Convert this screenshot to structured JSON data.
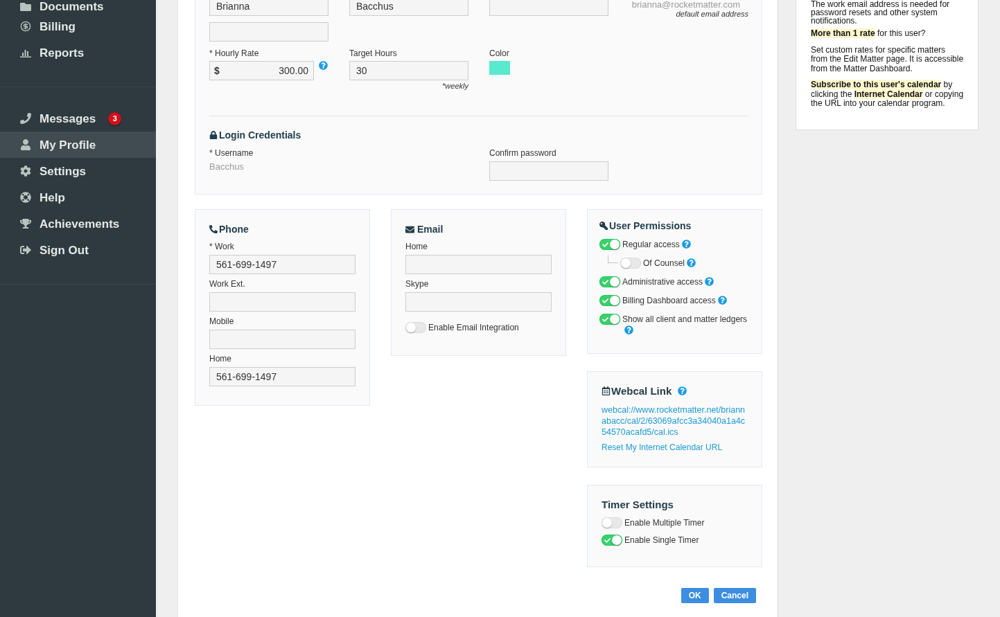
{
  "sidebar": {
    "groups": [
      {
        "items": [
          {
            "label": "Documents",
            "selected": false
          },
          {
            "label": "Billing",
            "selected": false
          },
          {
            "label": "Reports",
            "selected": false
          }
        ]
      },
      {
        "items": [
          {
            "label": "Messages",
            "selected": false,
            "badge": "3"
          },
          {
            "label": "My Profile",
            "selected": true
          },
          {
            "label": "Settings",
            "selected": false
          },
          {
            "label": "Help",
            "selected": false
          },
          {
            "label": "Achievements",
            "selected": false
          },
          {
            "label": "Sign Out",
            "selected": false
          }
        ]
      }
    ]
  },
  "profile": {
    "name_row": [
      "Brianna",
      "Bacchus"
    ],
    "email": "brianna@rocketmatter.com",
    "email_note": "default email address",
    "hourly_rate": {
      "label": "* Hourly Rate",
      "prefix": "$",
      "value": "300.00"
    },
    "target_hours": {
      "label": "Target Hours",
      "value": "30",
      "note": "*weekly"
    },
    "color": {
      "label": "Color",
      "color": "#58eacd"
    }
  },
  "login": {
    "title": "Login Credentials",
    "username_label": "* Username",
    "username": "Bacchus",
    "confirm_label": "Confirm password"
  },
  "phone": {
    "title": "Phone",
    "fields": [
      {
        "label": "* Work",
        "value": "561-699-1497"
      },
      {
        "label": "Work Ext."
      },
      {
        "label": "Mobile"
      },
      {
        "label": "Home",
        "value": "561-699-1497"
      }
    ]
  },
  "email": {
    "title": "Email",
    "fields": [
      {
        "label": "Home"
      },
      {
        "label": "Skype"
      }
    ],
    "integration": {
      "label": "Enable Email Integration",
      "on": false
    }
  },
  "permissions": {
    "title": "User Permissions",
    "items": [
      {
        "label": "Regular access",
        "on": true,
        "children": [
          {
            "label": "Of Counsel",
            "on": false
          }
        ]
      },
      {
        "label": "Administrative access",
        "on": true
      },
      {
        "label": "Billing Dashboard access",
        "on": true
      },
      {
        "label": "Show all client and matter ledgers",
        "on": true
      }
    ]
  },
  "webcal": {
    "title": "Webcal Link",
    "url": "webcal://www.rocketmatter.net/briannabacc/cal/2/63069afcc3a34040a1a4c54570acafd5/cal.ics",
    "reset_link": "Reset My Internet Calendar URL"
  },
  "timer": {
    "title": "Timer Settings",
    "items": [
      {
        "label": "Enable Multiple Timer",
        "on": false
      },
      {
        "label": "Enable Single Timer",
        "on": true
      }
    ]
  },
  "buttons": [
    "OK",
    "Cancel"
  ],
  "help_panel": {
    "paragraphs": [
      "The work email address is needed for password resets and other system notifications.",
      "**More than 1 rate** for this user?",
      "Set custom rates for specific matters from the Edit Matter page. It is accessible from the Matter Dashboard.",
      "**Subscribe to this user's calendar** by clicking the **Internet Calendar** or copying the URL into your calendar program."
    ]
  }
}
